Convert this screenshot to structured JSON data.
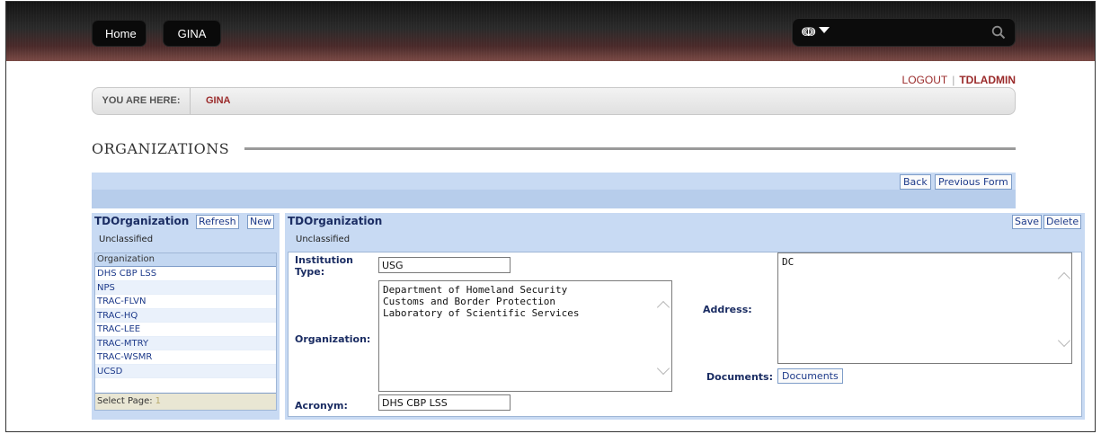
{
  "nav": {
    "home": "Home",
    "gina": "GINA"
  },
  "search": {
    "placeholder": "",
    "lang_icon": "translate-icon"
  },
  "session": {
    "logout": "LOGOUT",
    "separator": "|",
    "user": "TDLADMIN"
  },
  "breadcrumb": {
    "label": "YOU ARE HERE:",
    "item": "GINA"
  },
  "page": {
    "title": "ORGANIZATIONS"
  },
  "form_toolbar": {
    "back": "Back",
    "previous_form": "Previous Form"
  },
  "left_panel": {
    "title": "TDOrganization",
    "refresh": "Refresh",
    "new": "New",
    "classification": "Unclassified",
    "column_header": "Organization",
    "rows": [
      "DHS CBP LSS",
      "NPS",
      "TRAC-FLVN",
      "TRAC-HQ",
      "TRAC-LEE",
      "TRAC-MTRY",
      "TRAC-WSMR",
      "UCSD"
    ],
    "select_page_label": "Select Page:",
    "page_number": "1"
  },
  "right_panel": {
    "title": "TDOrganization",
    "save": "Save",
    "delete": "Delete",
    "classification": "Unclassified",
    "fields": {
      "institution_type_label": "Institution Type:",
      "institution_type_value": "USG",
      "organization_label": "Organization:",
      "organization_value": "Department of Homeland Security\nCustoms and Border Protection\nLaboratory of Scientific Services",
      "acronym_label": "Acronym:",
      "acronym_value": "DHS CBP LSS",
      "address_label": "Address:",
      "address_value": "DC",
      "documents_label": "Documents:",
      "documents_button": "Documents"
    }
  },
  "colors": {
    "accent_red": "#9a2a2a",
    "panel_blue": "#c8daf3",
    "link_blue": "#1d3a8a"
  }
}
